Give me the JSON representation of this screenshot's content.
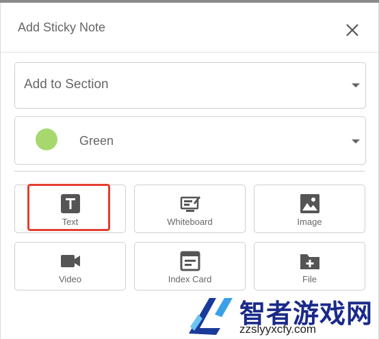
{
  "dialog": {
    "title": "Add Sticky Note",
    "close_icon": "close-icon"
  },
  "section_select": {
    "value": "Add to Section"
  },
  "color_select": {
    "value": "Green",
    "swatch_color": "#a6d86e"
  },
  "note_types": [
    {
      "label": "Text",
      "icon": "text-icon"
    },
    {
      "label": "Whiteboard",
      "icon": "whiteboard-icon"
    },
    {
      "label": "Image",
      "icon": "image-icon"
    },
    {
      "label": "Video",
      "icon": "video-icon"
    },
    {
      "label": "Index Card",
      "icon": "index-card-icon"
    },
    {
      "label": "File",
      "icon": "file-add-icon"
    }
  ],
  "highlight_color": "#e43d2f",
  "watermark": {
    "text": "智者游戏网",
    "url": "zzslyyxcfy.com",
    "brand_color": "#1a2a8a"
  }
}
